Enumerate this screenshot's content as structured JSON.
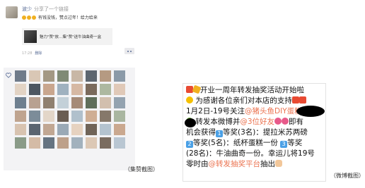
{
  "moments": {
    "user_name": "波少",
    "share_text": "分享了一个链接",
    "post_text": "有钱没钱，赞点过年！给力给来",
    "link_title": "魅力\"赞\"放…集\"赞\"送牛油曲奇一盒",
    "time": "17:28",
    "delete_label": "删除",
    "avatar_colors": [
      "#6f7b8a",
      "#d9c7b5",
      "#a39884",
      "#7f8a75",
      "#c8b7a6",
      "#5d6670",
      "#b59a82",
      "#8b9aa8",
      "#e2d3c4",
      "#4c5661",
      "#c9a68e",
      "#9fb1bf",
      "#d6b8a3",
      "#7a6a5c",
      "#adb8a0",
      "#e0c9b8",
      "#6e7f8f",
      "#b8a191",
      "#8f8070",
      "#c3d0d8",
      "#a58a77",
      "#5f6e5a",
      "#d2bfae",
      "#94a3b0",
      "#bfa48f",
      "#7c8c99",
      "#e3d6c8",
      "#6a5d52",
      "#b0c0cc",
      "#cfae94",
      "#86786a",
      "#a9b6a0",
      "#d8c3b0",
      "#5a6470",
      "#c1a793",
      "#9aa9b6",
      "#e6d2c0",
      "#706458",
      "#b4c3cf",
      "#caa88f",
      "#8a9b88",
      "#d4bba6",
      "#667482",
      "#bda08a",
      "#a2b1bd",
      "#dcc8b5",
      "#7a6c60",
      "#b9c6d2"
    ]
  },
  "captions": {
    "likes": "（集赞截图）",
    "weibo": "（微博截图）"
  },
  "weibo": {
    "line1": "开业一周年转发抽奖活动开始啦",
    "line2": "为感谢各位亲们对本店的支持",
    "line3_a": "1月2日-19号关注",
    "line3_at": "@猪头鱼DIY蛋糕",
    "line4_a": "转发本微博并",
    "line4_at": "@3位好友",
    "line4_b": "即有",
    "line5_a": "机会获得",
    "badge1": "1",
    "line5_b": "等奖(3名)：提拉米苏两磅",
    "badge2": "2",
    "line6_a": "等奖(5名)：纸杯蛋糕一份",
    "badge3": "3",
    "line6_b": "等奖",
    "line7": "(28名)：牛油曲奇一份。幸运儿将19号",
    "line8_a": "零时由",
    "line8_at": "@转发抽奖平台",
    "line8_b": "抽出"
  }
}
